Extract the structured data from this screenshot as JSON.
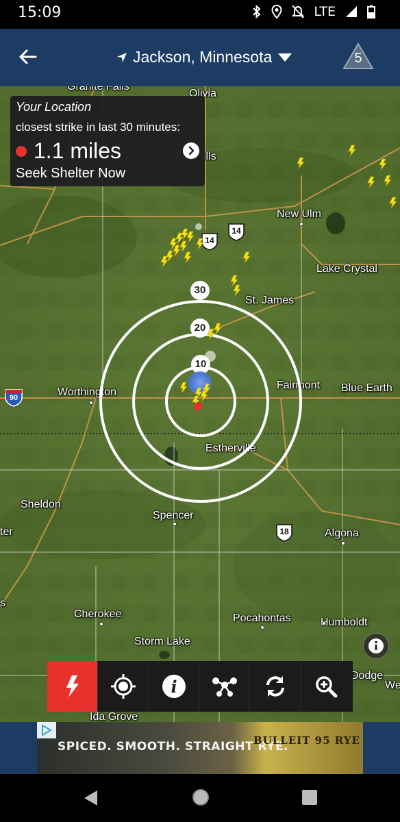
{
  "status_bar": {
    "time": "15:09",
    "network": "LTE",
    "icons": [
      "bluetooth-icon",
      "location-icon",
      "notifications-off-icon",
      "signal-icon",
      "battery-icon"
    ]
  },
  "app_bar": {
    "location": "Jackson, Minnesota",
    "alert_count": "5",
    "back_icon": "arrow-left-icon",
    "dropdown_icon": "caret-down-icon"
  },
  "info_card": {
    "title": "Your Location",
    "subtitle": "closest strike in last 30 minutes:",
    "distance": "1.1  miles",
    "advice": "Seek Shelter Now"
  },
  "map": {
    "places": [
      "Granite Falls",
      "Olivia",
      "New Ulm",
      "Lake Crystal",
      "St. James",
      "Worthington",
      "Fairmont",
      "Blue Earth",
      "Estherville",
      "Sheldon",
      "Spencer",
      "Algona",
      "Cherokee",
      "Pocahontas",
      "Humboldt",
      "Storm Lake",
      "Dodge",
      "Ida Grove",
      "ills",
      "ter",
      "s",
      "We"
    ],
    "highways": [
      "14",
      "14",
      "18",
      "90"
    ],
    "rings": [
      "10",
      "20",
      "30"
    ],
    "colors": {
      "strike": "#f5e21b",
      "user_marker": "#4a78d6",
      "closest_strike": "#e8302c"
    }
  },
  "toolbar": {
    "items": [
      "lightning-icon",
      "crosshair-icon",
      "info-icon",
      "network-icon",
      "refresh-icon",
      "zoom-in-icon"
    ]
  },
  "ad": {
    "headline": "SPICED. SMOOTH. STRAIGHT RYE.",
    "brand": "BULLEIT 95 RYE"
  }
}
